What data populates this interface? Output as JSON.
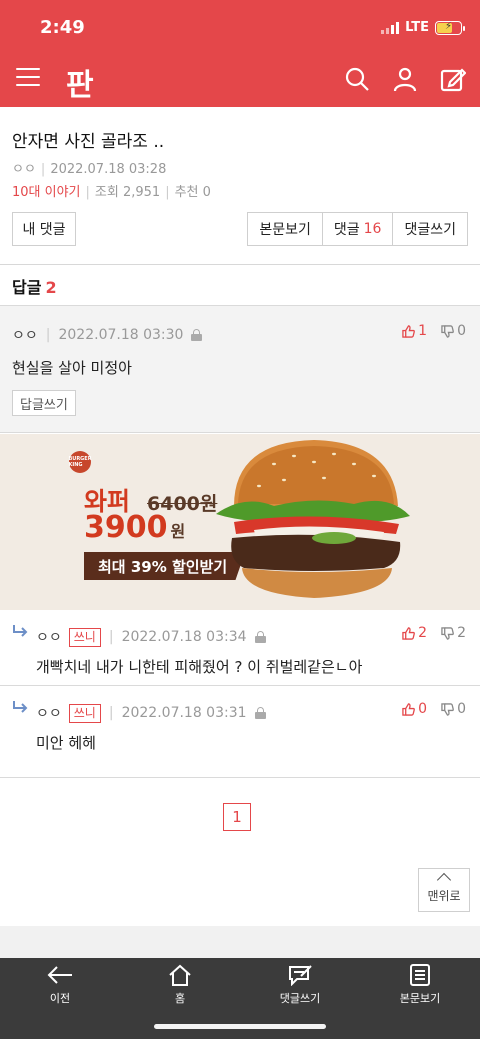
{
  "status_bar": {
    "time": "2:49",
    "network": "LTE"
  },
  "header": {
    "logo": "판"
  },
  "post": {
    "title": "안자면 사진 골라조 ..",
    "author": "ㅇㅇ",
    "date": "2022.07.18 03:28",
    "category": "10대 이야기",
    "views_label": "조회",
    "views": "2,951",
    "recommend_label": "추천",
    "recommend": "0"
  },
  "buttons": {
    "my_comment": "내 댓글",
    "view_body": "본문보기",
    "comments_label": "댓글",
    "comments_count": "16",
    "write_comment": "댓글쓰기"
  },
  "replies_section": {
    "title": "답글",
    "count": "2"
  },
  "best_reply": {
    "author": "ㅇㅇ",
    "date": "2022.07.18 03:30",
    "text": "현실을 살아 미정아",
    "up": "1",
    "down": "0",
    "reply_button": "답글쓰기"
  },
  "ad": {
    "brand": "BURGER KING",
    "product": "와퍼",
    "old_price": "6400원",
    "new_price": "3900",
    "currency": "원",
    "badge": "최대 39% 할인받기"
  },
  "replies": [
    {
      "author": "ㅇㅇ",
      "badge": "쓰니",
      "date": "2022.07.18 03:34",
      "text": "개빡치네 내가 니한테 피해줬어 ? 이 쥐벌레같은ㄴ아",
      "up": "2",
      "down": "2"
    },
    {
      "author": "ㅇㅇ",
      "badge": "쓰니",
      "date": "2022.07.18 03:31",
      "text": "미안 헤헤",
      "up": "0",
      "down": "0"
    }
  ],
  "pagination": {
    "current": "1"
  },
  "top_button": "맨위로",
  "bottom_nav": [
    {
      "label": "이전",
      "icon": "arrow-left-icon"
    },
    {
      "label": "홈",
      "icon": "home-icon"
    },
    {
      "label": "댓글쓰기",
      "icon": "write-comment-icon"
    },
    {
      "label": "본문보기",
      "icon": "document-icon"
    }
  ],
  "colors": {
    "accent": "#e4474a",
    "bottom_bar": "#3b3b3b"
  }
}
